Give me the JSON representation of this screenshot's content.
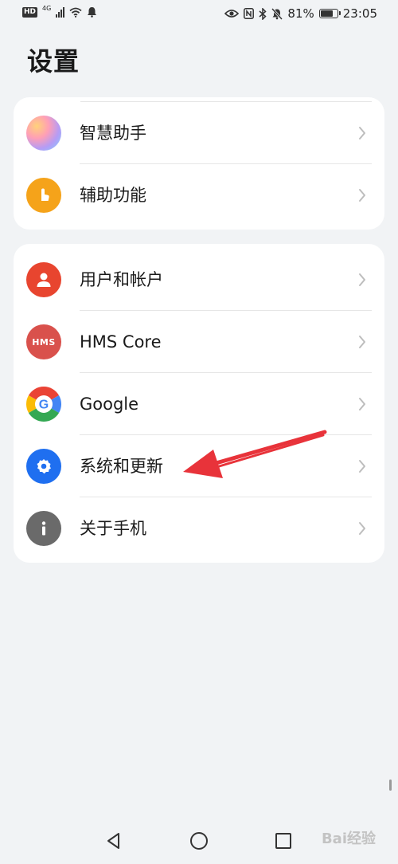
{
  "status_bar": {
    "left_badge": "HD",
    "signal_label": "4G",
    "battery_percent": "81%",
    "battery_level": 0.81,
    "time": "23:05",
    "icons_left": [
      "hd-icon",
      "cellular-signal-icon",
      "wifi-icon",
      "notification-bell-icon"
    ],
    "icons_right": [
      "eye-icon",
      "nfc-icon",
      "bluetooth-icon",
      "mute-bell-icon",
      "battery-icon"
    ]
  },
  "page": {
    "title": "设置"
  },
  "groups": [
    {
      "items": [
        {
          "label": "智慧助手",
          "icon": "assistant-icon"
        },
        {
          "label": "辅助功能",
          "icon": "accessibility-icon"
        }
      ]
    },
    {
      "items": [
        {
          "label": "用户和帐户",
          "icon": "user-icon"
        },
        {
          "label": "HMS Core",
          "icon": "hms-icon",
          "icon_text": "HMS"
        },
        {
          "label": "Google",
          "icon": "google-icon"
        },
        {
          "label": "系统和更新",
          "icon": "gear-icon"
        },
        {
          "label": "关于手机",
          "icon": "info-icon"
        }
      ]
    }
  ],
  "annotation": {
    "type": "red-arrow",
    "points_to": "系统和更新",
    "color": "#e8333a"
  },
  "navigation_bar": {
    "buttons": [
      "back-icon",
      "home-icon",
      "recent-apps-icon"
    ]
  },
  "watermark": {
    "text": "Bai经验"
  },
  "colors": {
    "background": "#f1f3f5",
    "card": "#ffffff",
    "accessibility": "#f5a31a",
    "user": "#e8452f",
    "hms": "#d9514c",
    "system": "#1f6ff0",
    "about": "#6a6a6a"
  }
}
